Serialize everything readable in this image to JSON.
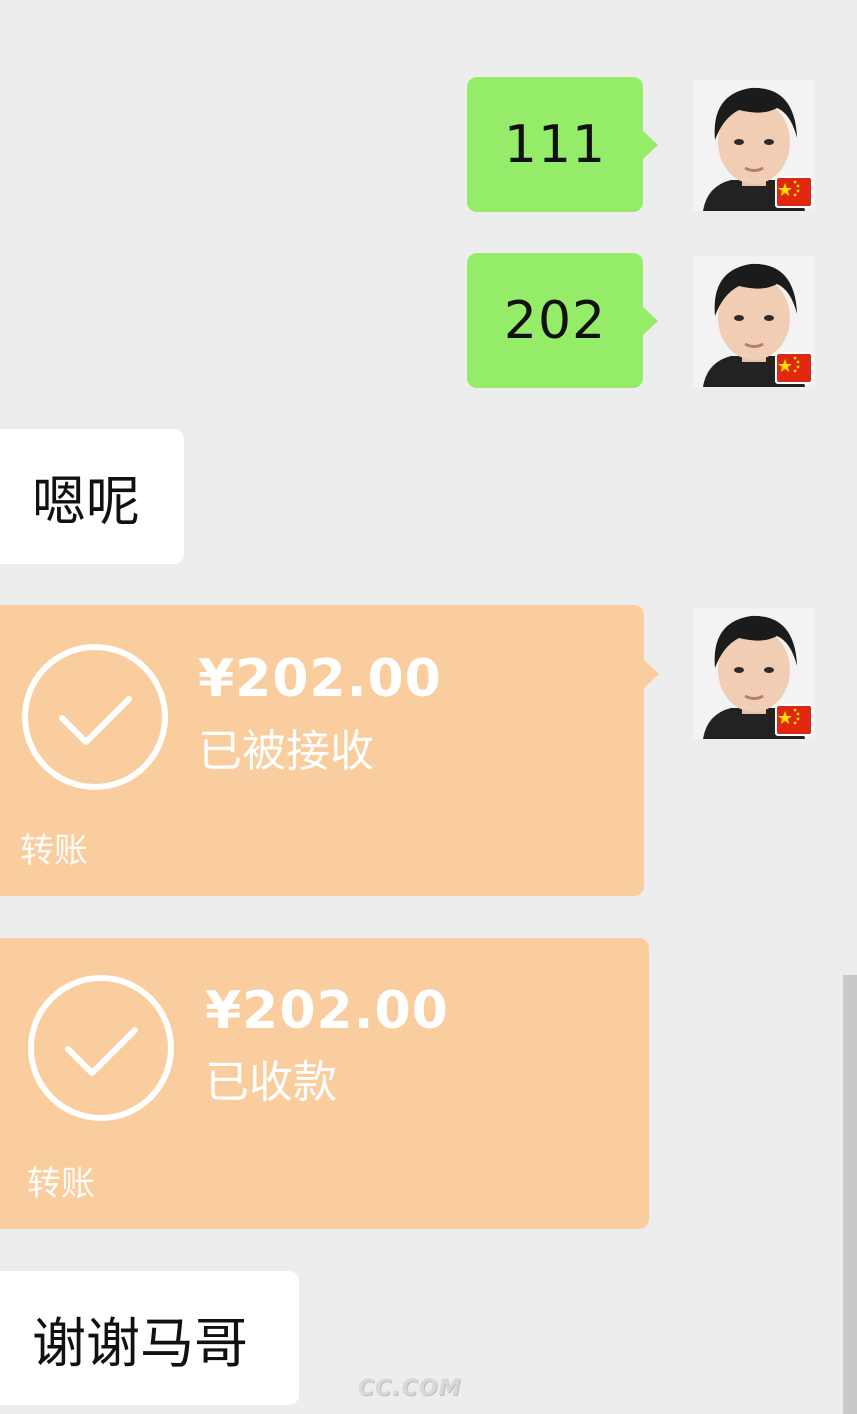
{
  "messages": {
    "sent_1": "111",
    "sent_2": "202",
    "received_1": "嗯呢",
    "received_2": "谢谢马哥"
  },
  "transfer_sent": {
    "amount": "¥202.00",
    "status": "已被接收",
    "label": "转账"
  },
  "transfer_received": {
    "amount": "¥202.00",
    "status": "已收款",
    "label": "转账"
  },
  "watermark": "CC.COM",
  "colors": {
    "background": "#ededed",
    "sent_bubble": "#95ec69",
    "received_bubble": "#ffffff",
    "transfer_card": "#f9cd9e",
    "flag_red": "#de2910",
    "flag_star": "#ffde00"
  },
  "icons": {
    "transfer_status": "check-circle-icon",
    "avatar_badge": "china-flag-icon"
  }
}
